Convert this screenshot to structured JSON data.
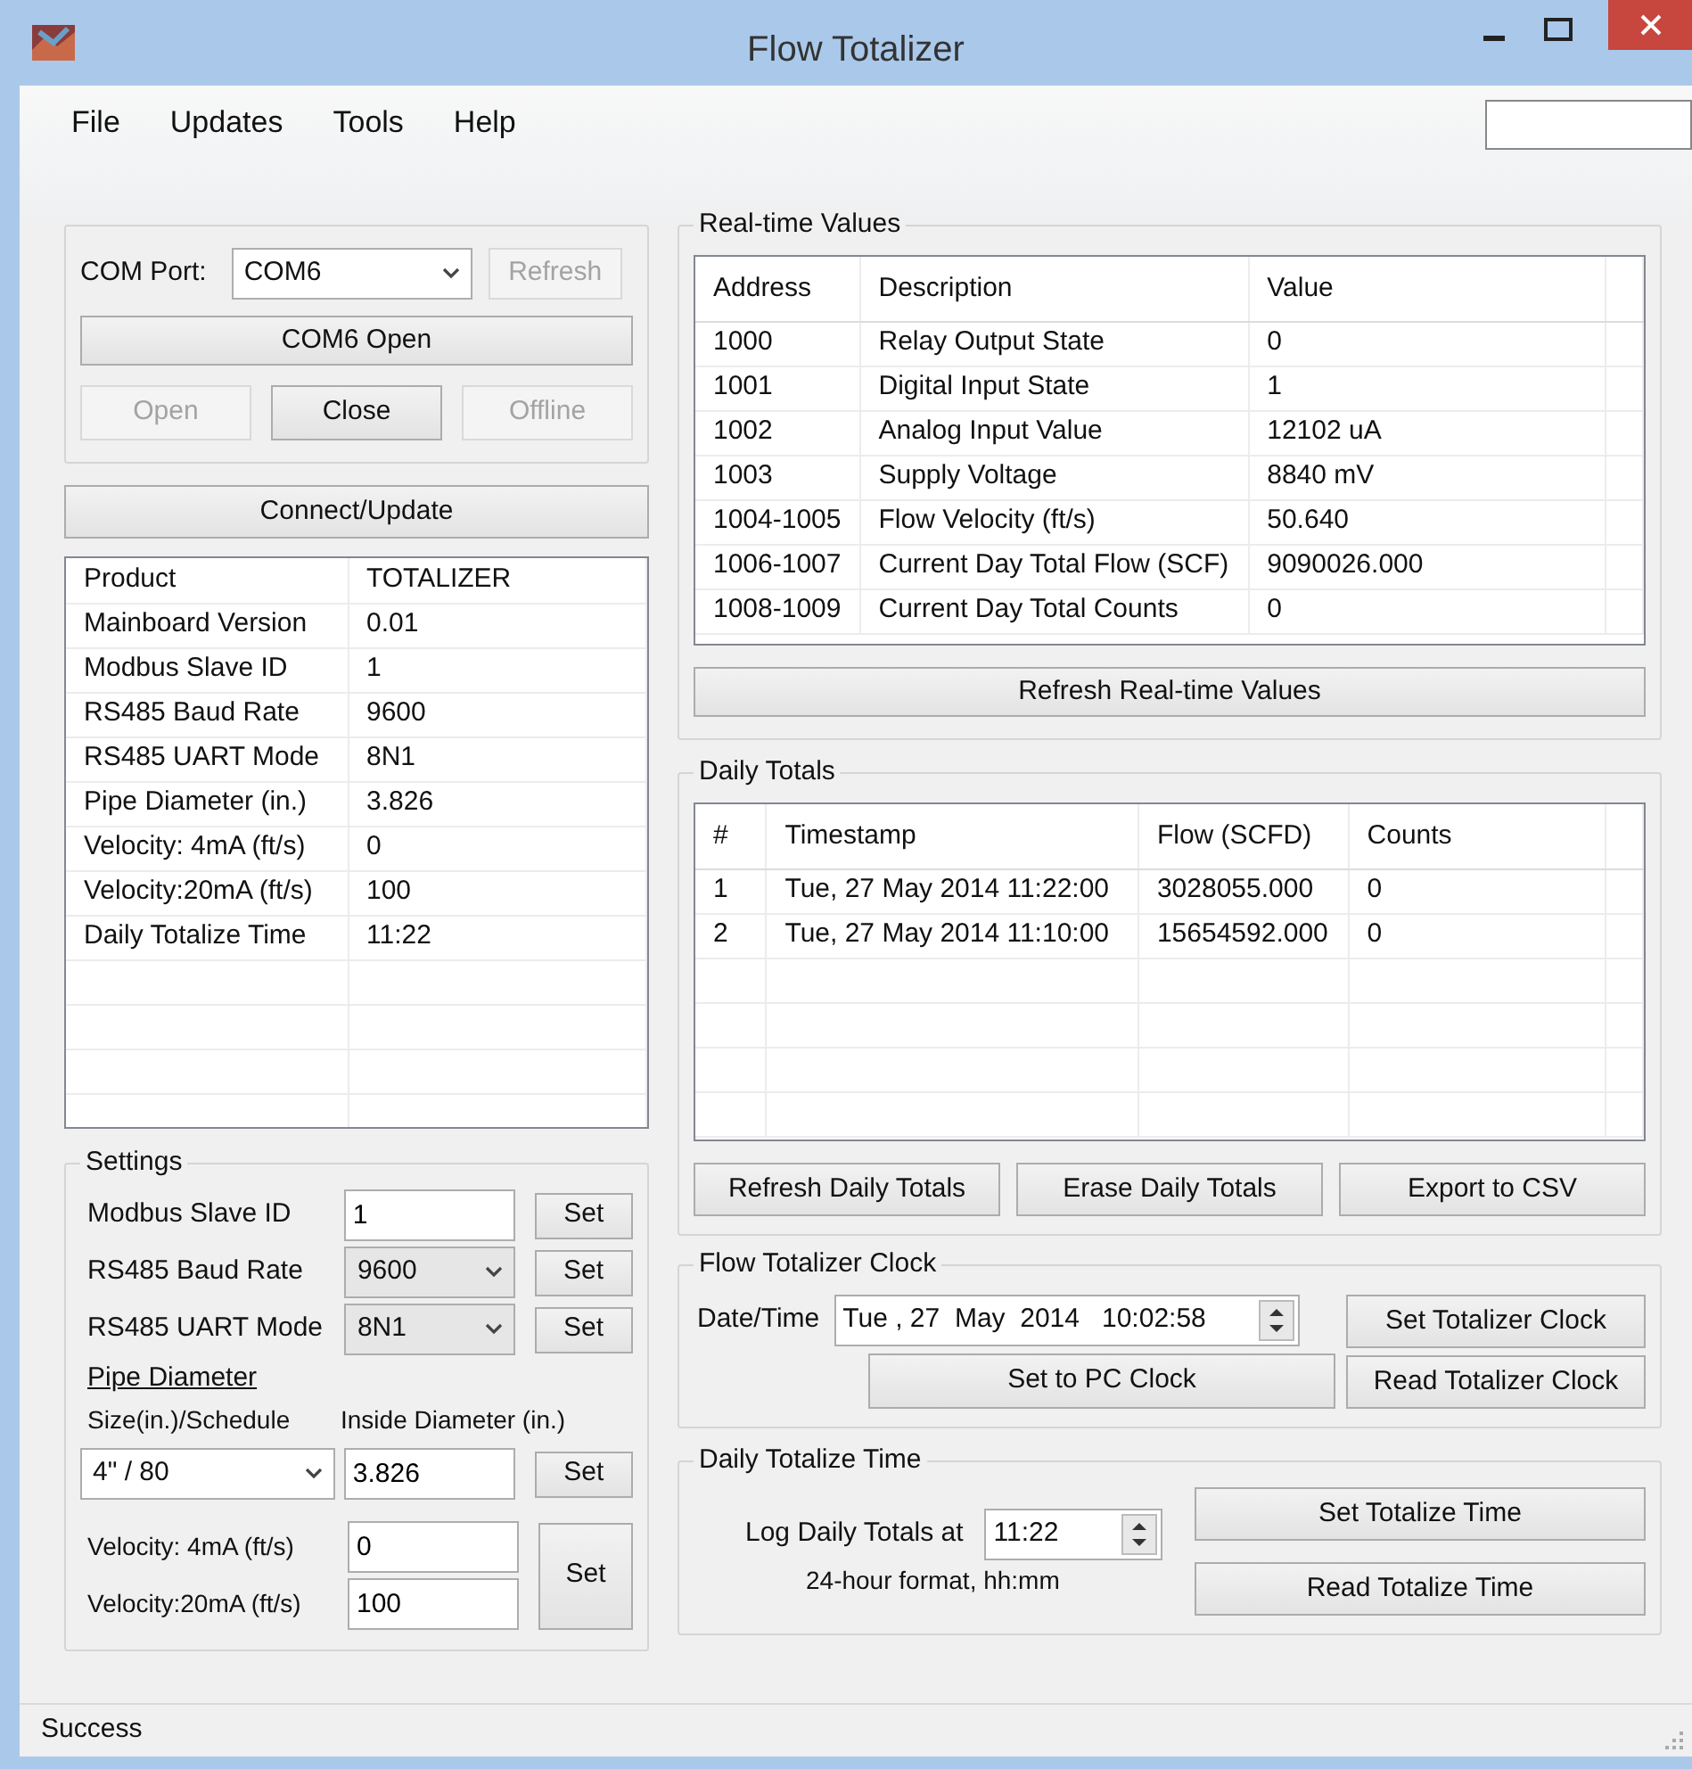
{
  "window": {
    "title": "Flow Totalizer"
  },
  "menu": [
    "File",
    "Updates",
    "Tools",
    "Help"
  ],
  "com_port": {
    "label": "COM Port:",
    "value": "COM6",
    "refresh": {
      "label": "Refresh",
      "disabled": true
    },
    "status_button": "COM6 Open",
    "buttons": [
      {
        "label": "Open",
        "disabled": true
      },
      {
        "label": "Close",
        "disabled": false
      },
      {
        "label": "Offline",
        "disabled": true
      }
    ]
  },
  "connect_button": "Connect/Update",
  "device_info": [
    {
      "label": "Product",
      "value": "TOTALIZER"
    },
    {
      "label": "Mainboard Version",
      "value": "0.01"
    },
    {
      "label": "Modbus Slave ID",
      "value": "1"
    },
    {
      "label": "RS485 Baud Rate",
      "value": "9600"
    },
    {
      "label": "RS485 UART Mode",
      "value": "8N1"
    },
    {
      "label": "Pipe Diameter (in.)",
      "value": "3.826"
    },
    {
      "label": "Velocity:  4mA (ft/s)",
      "value": "0"
    },
    {
      "label": "Velocity:20mA (ft/s)",
      "value": "100"
    },
    {
      "label": "Daily Totalize Time",
      "value": "11:22"
    }
  ],
  "settings": {
    "title": "Settings",
    "fields": [
      {
        "kind": "text",
        "label": "Modbus Slave ID",
        "value": "1",
        "button": "Set"
      },
      {
        "kind": "select",
        "label": "RS485 Baud Rate",
        "value": "9600",
        "button": "Set"
      },
      {
        "kind": "select",
        "label": "RS485 UART Mode",
        "value": "8N1",
        "button": "Set"
      }
    ],
    "pipe": {
      "heading": "Pipe Diameter",
      "size_label": "Size(in.)/Schedule",
      "inside_label": "Inside Diameter (in.)",
      "size_value": "4\" / 80",
      "inside_value": "3.826",
      "button": "Set"
    },
    "velocity": {
      "fields": [
        {
          "label": "Velocity:  4mA (ft/s)",
          "value": "0"
        },
        {
          "label": "Velocity:20mA (ft/s)",
          "value": "100"
        }
      ],
      "button": "Set"
    }
  },
  "realtime": {
    "title": "Real-time Values",
    "columns": [
      "Address",
      "Description",
      "Value"
    ],
    "rows": [
      [
        "1000",
        "Relay Output State",
        "0"
      ],
      [
        "1001",
        "Digital Input State",
        "1"
      ],
      [
        "1002",
        "Analog Input Value",
        "12102 uA"
      ],
      [
        "1003",
        "Supply Voltage",
        "8840 mV"
      ],
      [
        "1004-1005",
        "Flow Velocity (ft/s)",
        "50.640"
      ],
      [
        "1006-1007",
        "Current Day Total Flow (SCF)",
        "9090026.000"
      ],
      [
        "1008-1009",
        "Current Day Total Counts",
        "0"
      ]
    ],
    "button": "Refresh Real-time Values"
  },
  "daily_totals": {
    "title": "Daily Totals",
    "columns": [
      "#",
      "Timestamp",
      "Flow (SCFD)",
      "Counts"
    ],
    "rows": [
      [
        "1",
        "Tue, 27 May 2014 11:22:00",
        "3028055.000",
        "0"
      ],
      [
        "2",
        "Tue, 27 May 2014 11:10:00",
        "15654592.000",
        "0"
      ]
    ],
    "buttons": [
      "Refresh Daily Totals",
      "Erase Daily Totals",
      "Export to CSV"
    ]
  },
  "clock": {
    "title": "Flow Totalizer Clock",
    "label": "Date/Time",
    "value": "Tue , 27  May  2014   10:02:58",
    "set_pc_button": "Set to PC Clock",
    "buttons": [
      "Set Totalizer Clock",
      "Read Totalizer Clock"
    ]
  },
  "totalize_time": {
    "title": "Daily Totalize Time",
    "label": "Log Daily Totals at",
    "value": "11:22",
    "hint": "24-hour format, hh:mm",
    "buttons": [
      "Set Totalize Time",
      "Read Totalize Time"
    ]
  },
  "status_bar": "Success"
}
